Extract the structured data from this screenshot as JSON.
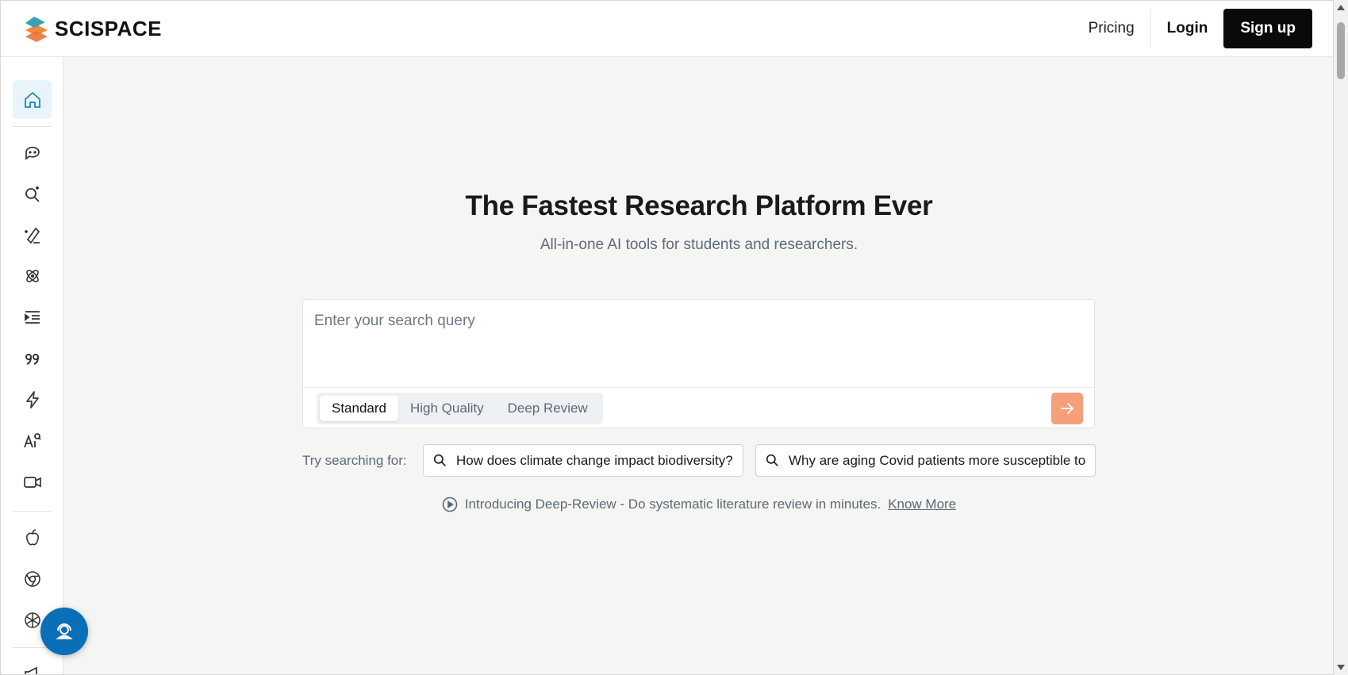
{
  "header": {
    "logo_text": "SCISPACE",
    "pricing_label": "Pricing",
    "login_label": "Login",
    "signup_label": "Sign up"
  },
  "sidebar": {
    "items": [
      {
        "icon": "home-icon",
        "active": true
      },
      {
        "icon": "chat-icon"
      },
      {
        "icon": "ai-search-icon"
      },
      {
        "icon": "ai-writer-icon"
      },
      {
        "icon": "atom-icon"
      },
      {
        "icon": "outline-icon"
      },
      {
        "icon": "citation-quote-icon"
      },
      {
        "icon": "lightning-icon"
      },
      {
        "icon": "ai-detector-icon"
      },
      {
        "icon": "video-icon"
      },
      {
        "icon": "apple-icon"
      },
      {
        "icon": "chrome-icon"
      },
      {
        "icon": "openai-icon"
      },
      {
        "icon": "megaphone-icon"
      }
    ]
  },
  "hero": {
    "title": "The Fastest Research Platform Ever",
    "subtitle": "All-in-one AI tools for students and researchers."
  },
  "search": {
    "placeholder": "Enter your search query",
    "value": "",
    "modes": [
      "Standard",
      "High Quality",
      "Deep Review"
    ],
    "selected_mode": "Standard"
  },
  "suggestions": {
    "label": "Try searching for:",
    "items": [
      "How does climate change impact biodiversity?",
      "Why are aging Covid patients more susceptible to"
    ]
  },
  "intro": {
    "text": "Introducing Deep-Review - Do systematic literature review in minutes.",
    "link_label": "Know More"
  },
  "colors": {
    "accent": "#f4a07a",
    "fab": "#0b6fb8",
    "active_sidebar": "#e8f4fa"
  }
}
